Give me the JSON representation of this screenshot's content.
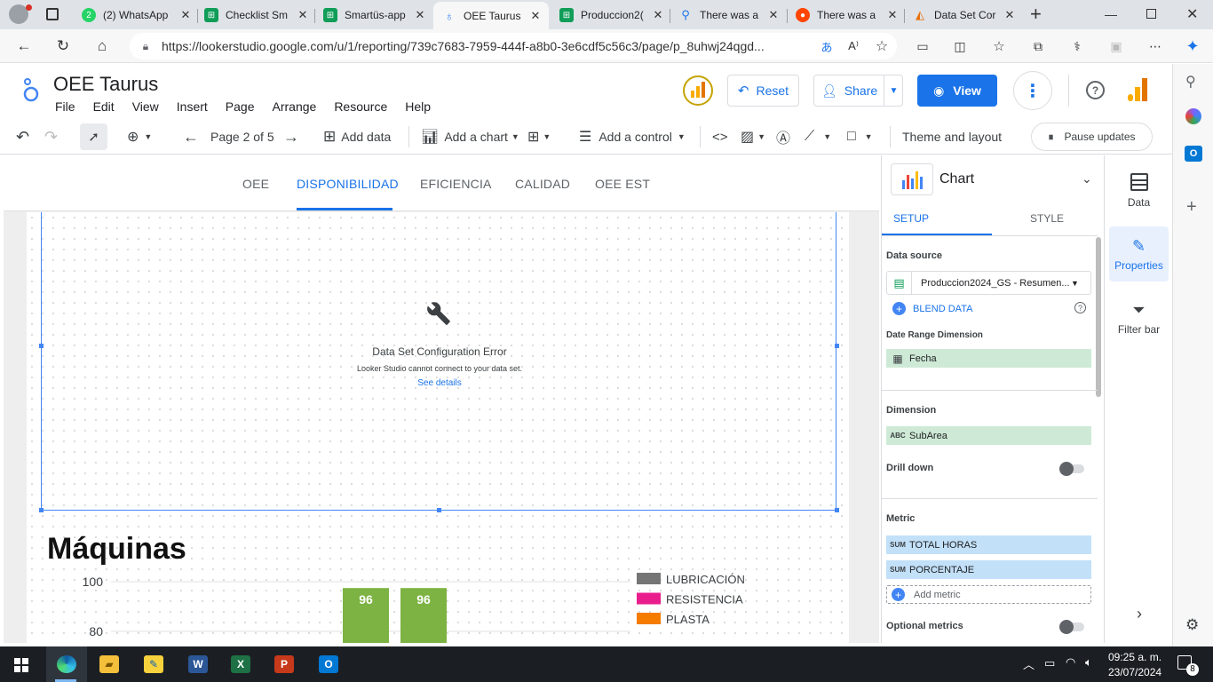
{
  "browser": {
    "tabs": [
      {
        "title": "(2) WhatsApp",
        "favicon_color": "#25d366",
        "favicon_text": "2"
      },
      {
        "title": "Checklist Sm",
        "favicon_color": "#0f9d58",
        "favicon_text": ""
      },
      {
        "title": "Smartüs-app",
        "favicon_color": "#0f9d58",
        "favicon_text": ""
      },
      {
        "title": "OEE Taurus",
        "favicon_color": "#4285f4",
        "favicon_text": ""
      },
      {
        "title": "Produccion2(",
        "favicon_color": "#0f9d58",
        "favicon_text": ""
      },
      {
        "title": "There was a",
        "favicon_color": "#1a73e8",
        "favicon_text": ""
      },
      {
        "title": "There was a",
        "favicon_color": "#ff4500",
        "favicon_text": ""
      },
      {
        "title": "Data Set Cor",
        "favicon_color": "#e8710a",
        "favicon_text": ""
      }
    ],
    "url": "https://lookerstudio.google.com/u/1/reporting/739c7683-7959-444f-a8b0-3e6cdf5c56c3/page/p_8uhwj24qgd..."
  },
  "app": {
    "title": "OEE Taurus",
    "menu": [
      "File",
      "Edit",
      "View",
      "Insert",
      "Page",
      "Arrange",
      "Resource",
      "Help"
    ],
    "reset_label": "Reset",
    "share_label": "Share",
    "view_label": "View"
  },
  "toolbar": {
    "page_indicator": "Page 2 of 5",
    "add_data": "Add data",
    "add_chart": "Add a chart",
    "add_control": "Add a control",
    "theme_layout": "Theme and layout",
    "pause_updates": "Pause updates"
  },
  "page_tabs": [
    "OEE",
    "DISPONIBILIDAD",
    "EFICIENCIA",
    "CALIDAD",
    "OEE EST"
  ],
  "active_page_tab": 1,
  "error": {
    "title": "Data Set Configuration Error",
    "message": "Looker Studio cannot connect to your data set.",
    "link": "See details"
  },
  "section_title": "Máquinas",
  "chart_data": {
    "type": "bar",
    "title": "",
    "categories": [
      "",
      ""
    ],
    "values": [
      96,
      96
    ],
    "ylim": [
      0,
      100
    ],
    "y_ticks": [
      80,
      100
    ],
    "bar_color": "#7cb342",
    "legend": [
      {
        "name": "LUBRICACIÓN",
        "color": "#757575"
      },
      {
        "name": "RESISTENCIA",
        "color": "#e91e8c"
      },
      {
        "name": "PLASTA",
        "color": "#f57c00"
      }
    ],
    "legend_placement": "right"
  },
  "panel": {
    "title": "Chart",
    "tabs": [
      "SETUP",
      "STYLE"
    ],
    "data_source_label": "Data source",
    "data_source_value": "Produccion2024_GS - Resumen...",
    "blend_label": "BLEND DATA",
    "date_range_label": "Date Range Dimension",
    "date_range_value": "Fecha",
    "dimension_label": "Dimension",
    "dimension_tag": "ABC",
    "dimension_value": "SubArea",
    "drill_down_label": "Drill down",
    "metric_label": "Metric",
    "metrics": [
      {
        "tag": "SUM",
        "name": "TOTAL HORAS"
      },
      {
        "tag": "SUM",
        "name": "PORCENTAJE"
      }
    ],
    "add_metric": "Add metric",
    "optional_metrics_label": "Optional metrics"
  },
  "sidebar": {
    "items": [
      "Data",
      "Properties",
      "Filter bar"
    ]
  },
  "taskbar": {
    "time": "09:25 a. m.",
    "date": "23/07/2024",
    "notifications": "8"
  }
}
